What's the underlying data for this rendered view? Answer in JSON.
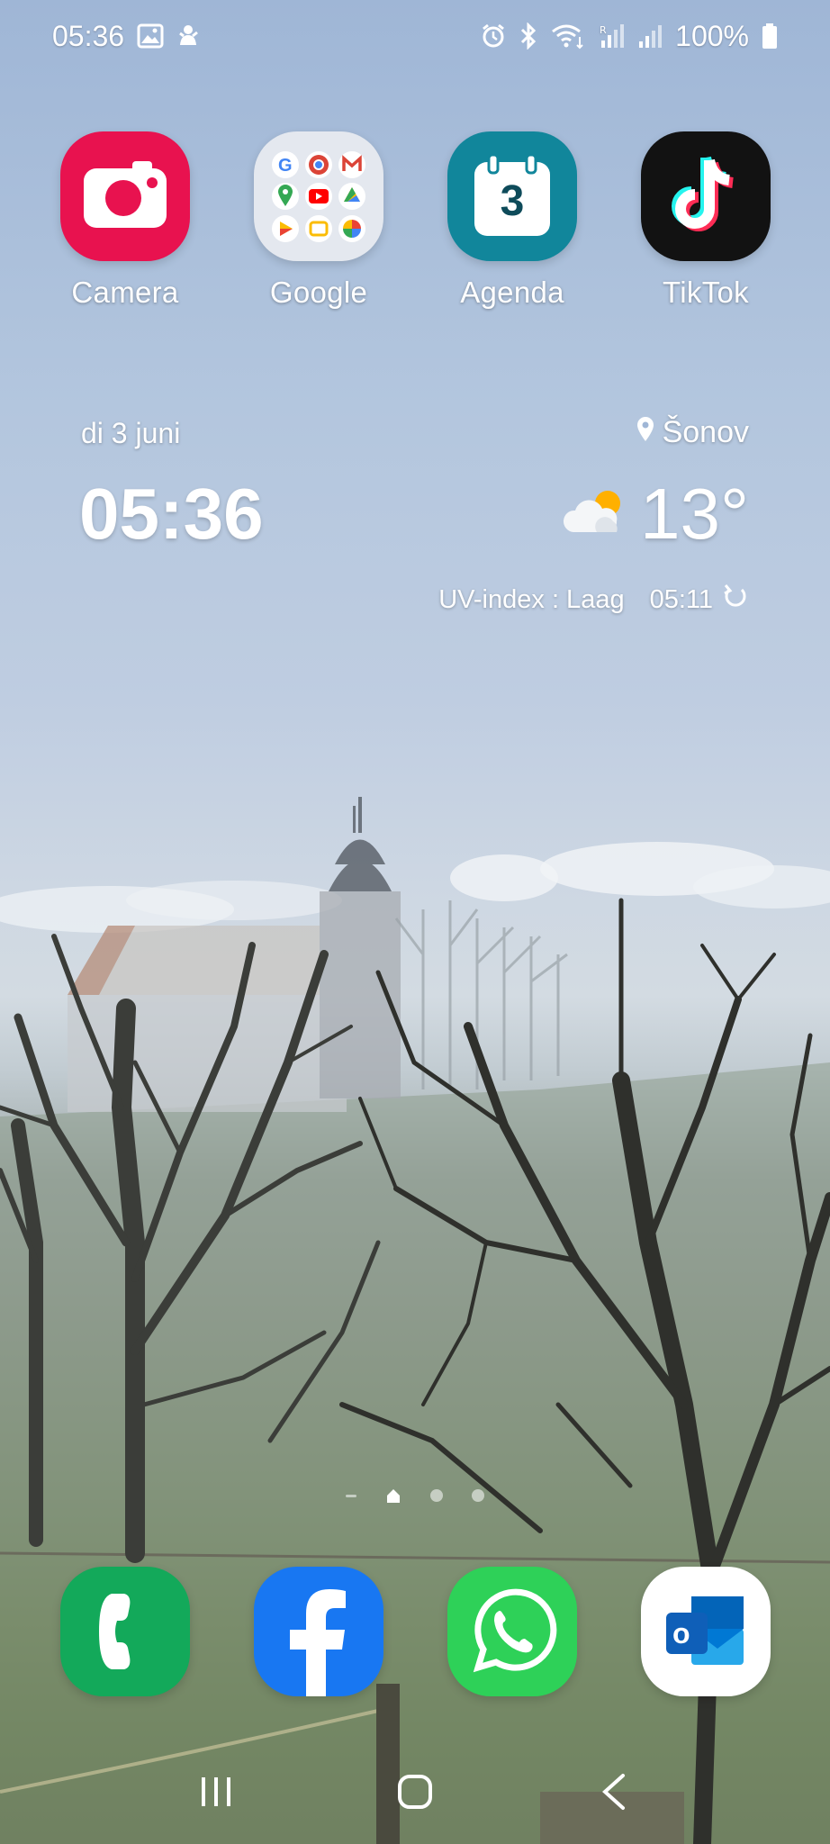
{
  "status_bar": {
    "time": "05:36",
    "left_icons": [
      "gallery-icon",
      "notification-app-icon"
    ],
    "right_icons": [
      "alarm-icon",
      "bluetooth-icon",
      "wifi-icon",
      "signal-r-icon",
      "signal-icon",
      "battery-icon"
    ],
    "battery": "100%"
  },
  "apps": [
    {
      "label": "Camera",
      "icon": "camera-icon",
      "color": "#e8124f"
    },
    {
      "label": "Google",
      "icon": "google-folder-icon",
      "color": "#e9ecf2"
    },
    {
      "label": "Agenda",
      "icon": "calendar-icon",
      "color": "#11869b",
      "day": "3"
    },
    {
      "label": "TikTok",
      "icon": "tiktok-icon",
      "color": "#121212"
    }
  ],
  "widget": {
    "date": "di 3 juni",
    "time": "05:36",
    "location": "Šonov",
    "temperature": "13°",
    "weather_icon": "partly-cloudy-icon",
    "uv": "UV-index : Laag",
    "updated": "05:11"
  },
  "page_indicator": {
    "pages": 4,
    "current": 0
  },
  "dock": [
    {
      "name": "phone",
      "icon": "phone-icon",
      "color": "#13a95a"
    },
    {
      "name": "facebook",
      "icon": "facebook-icon",
      "color": "#1877f2"
    },
    {
      "name": "whatsapp",
      "icon": "whatsapp-icon",
      "color": "#2ed158"
    },
    {
      "name": "outlook",
      "icon": "outlook-icon",
      "color": "#ffffff"
    }
  ],
  "nav_bar": [
    "recent-apps-icon",
    "home-icon",
    "back-icon"
  ]
}
